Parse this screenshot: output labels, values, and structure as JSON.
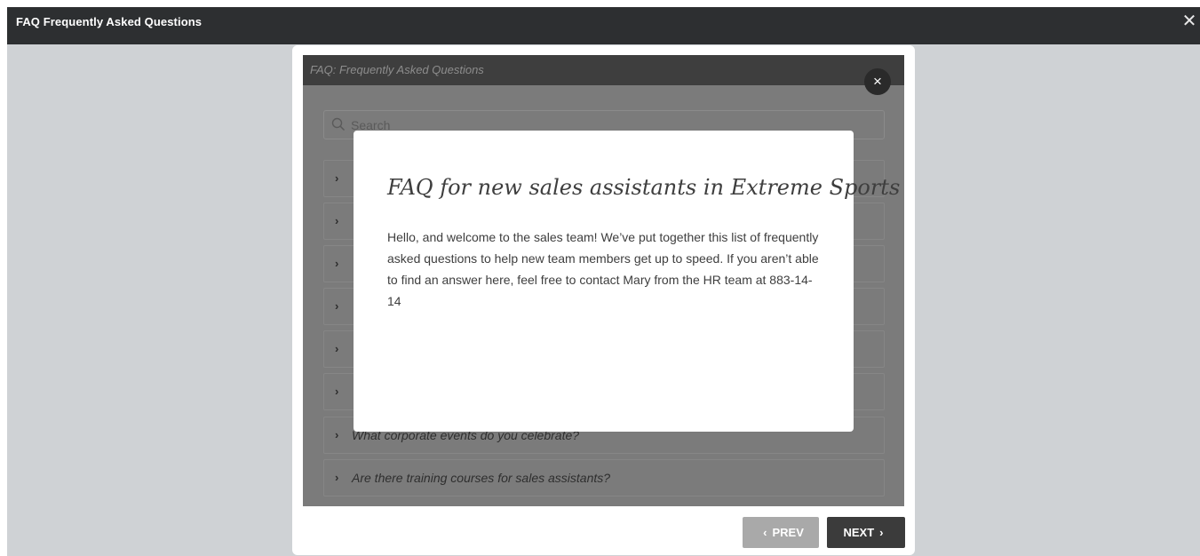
{
  "window": {
    "title": "FAQ Frequently Asked Questions",
    "close_glyph": "✕"
  },
  "slide": {
    "header_title": "FAQ: Frequently Asked Questions",
    "close_glyph": "×",
    "search_placeholder": "Search",
    "chevron_glyph": "›",
    "questions": [
      "",
      "",
      "",
      "",
      "",
      "",
      "What corporate events do you celebrate?",
      "Are there training courses for sales assistants?"
    ]
  },
  "popup": {
    "heading": "FAQ for new sales assistants in Extreme Sports",
    "body": "Hello, and welcome to the sales team! We’ve put together this list of frequently asked questions to help new team members get up to speed. If you aren’t able to find an answer here, feel free to contact Mary from the HR team at 883-14-14"
  },
  "nav": {
    "prev_label": "PREV",
    "next_label": "NEXT",
    "prev_glyph": "‹",
    "next_glyph": "›"
  },
  "colors": {
    "titlebar": "#2d2f31",
    "stage": "#cfd2d5",
    "slide_overlay": "#7b7b7b",
    "prev_button": "#a9a9a9",
    "next_button": "#3b3b3b"
  },
  "icons": [
    "close-icon",
    "search-icon",
    "chevron-right-icon",
    "chevron-left-icon"
  ]
}
